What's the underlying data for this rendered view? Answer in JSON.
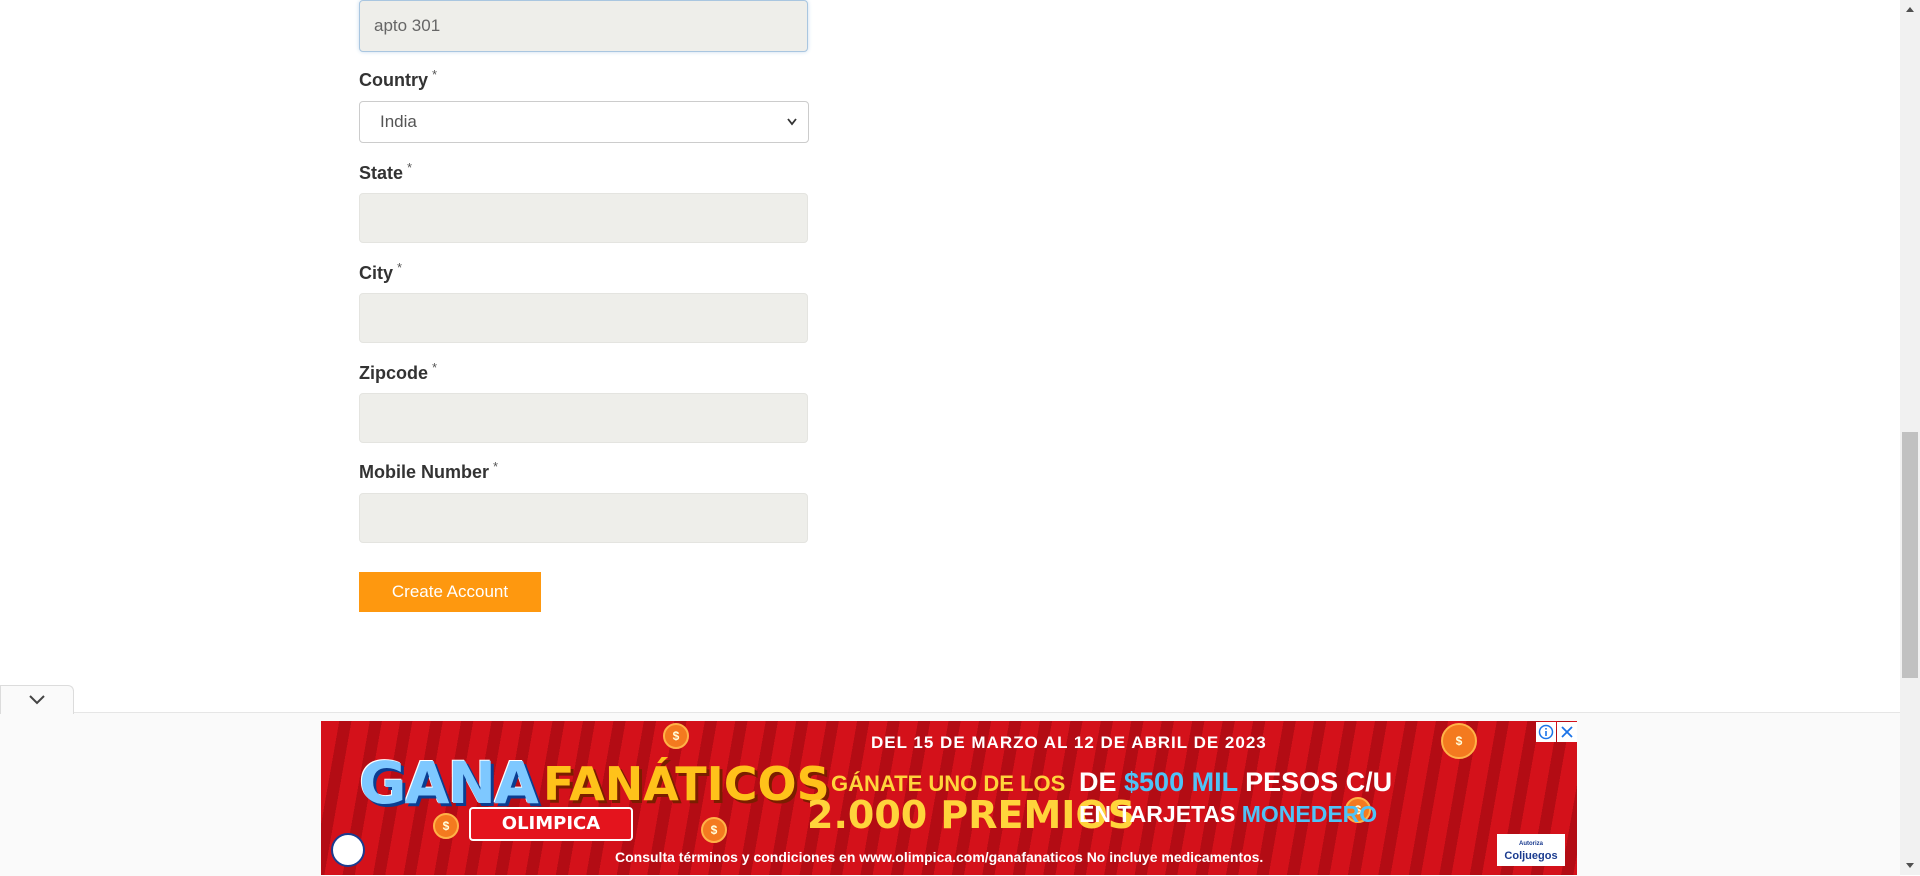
{
  "form": {
    "address2_value": "apto 301",
    "country": {
      "label": "Country",
      "required": "*",
      "selected": "India"
    },
    "state": {
      "label": "State",
      "required": "*",
      "value": ""
    },
    "city": {
      "label": "City",
      "required": "*",
      "value": ""
    },
    "zipcode": {
      "label": "Zipcode",
      "required": "*",
      "value": ""
    },
    "mobile": {
      "label": "Mobile Number",
      "required": "*",
      "value": ""
    },
    "submit_label": "Create Account"
  },
  "ad": {
    "logo_part1": "GANA",
    "logo_part2": "FANÁTICOS",
    "brand": "OLIMPICA",
    "dates": "DEL 15 DE MARZO AL 12 DE ABRIL DE 2023",
    "win_line1": "GÁNATE UNO DE LOS",
    "win_line2": "2.000 PREMIOS",
    "prize_line1_a": "DE ",
    "prize_line1_b": "$500 MIL",
    "prize_line1_c": " PESOS C/U",
    "prize_line2_a": "EN TARJETAS ",
    "prize_line2_b": "MONEDERO",
    "terms": "Consulta términos y condiciones en www.olimpica.com/ganafanaticos No incluye medicamentos.",
    "coljuegos": "Coljuegos",
    "coljuegos_small": "Autoriza",
    "info_icon": "i",
    "close_icon": "✕",
    "coin_symbol": "$"
  },
  "collapse_icon": "⌄"
}
